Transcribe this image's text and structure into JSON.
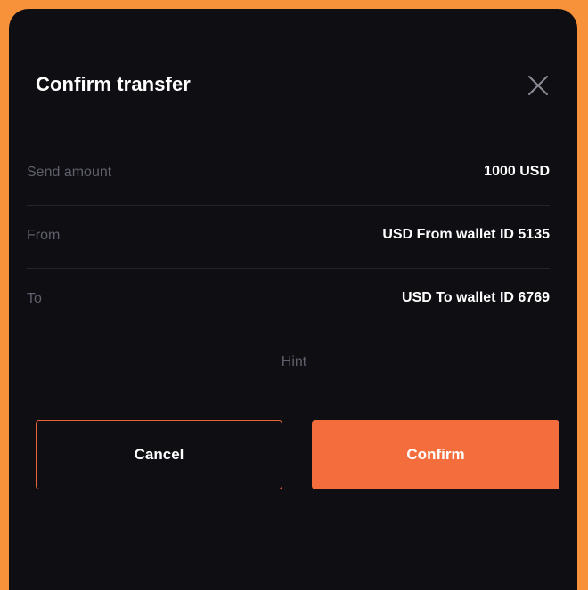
{
  "dialog": {
    "title": "Confirm transfer",
    "close_icon": "close-icon"
  },
  "details": [
    {
      "label": "Send amount",
      "value": "1000 USD"
    },
    {
      "label": "From",
      "value": "USD From wallet ID 5135"
    },
    {
      "label": "To",
      "value": "USD To wallet ID 6769"
    }
  ],
  "hint": "Hint",
  "actions": {
    "cancel_label": "Cancel",
    "confirm_label": "Confirm"
  },
  "colors": {
    "background": "#f7913a",
    "modal": "#0e0e13",
    "accent": "#f46d3d",
    "muted_text": "#5f606b"
  }
}
